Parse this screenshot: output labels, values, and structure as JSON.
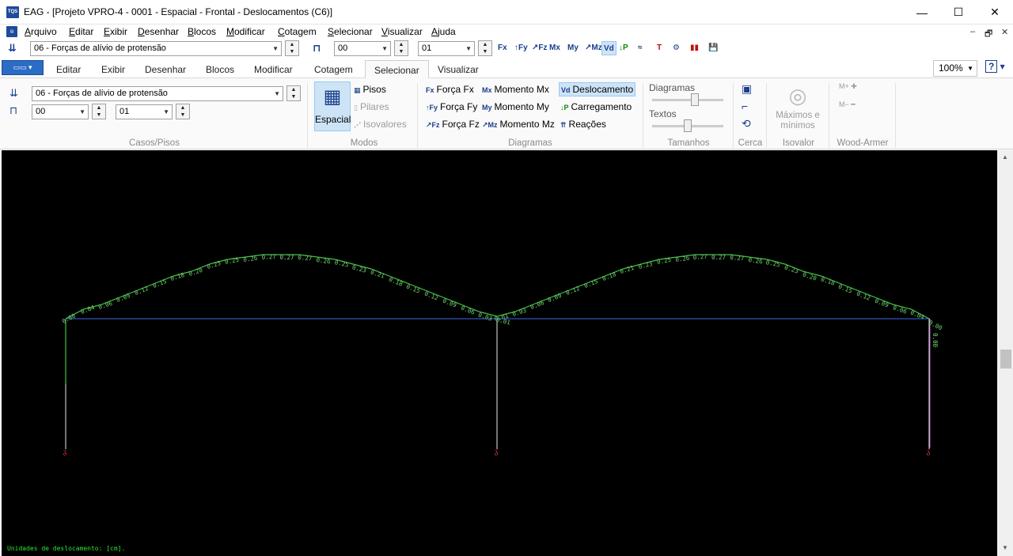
{
  "window": {
    "title": "EAG - [Projeto VPRO-4 - 0001 - Espacial - Frontal - Deslocamentos (C6)]",
    "app_icon": "TQS",
    "minimize_glyph": "—",
    "maximize_glyph": "☐",
    "close_glyph": "✕"
  },
  "menu": [
    "Arquivo",
    "Editar",
    "Exibir",
    "Desenhar",
    "Blocos",
    "Modificar",
    "Cotagem",
    "Selecionar",
    "Visualizar",
    "Ajuda"
  ],
  "mdi_controls": [
    "–",
    "🗗",
    "✕"
  ],
  "toolbar": {
    "case_value": "06 - Forças de alívio de protensão",
    "floor_from": "00",
    "floor_to": "01",
    "icons": [
      "fx-icon",
      "fy-icon",
      "fz-icon",
      "mx-icon",
      "my-icon",
      "mz-icon",
      "displacement-icon",
      "load-icon",
      "reactions-icon",
      "beam-icon",
      "settings-icon",
      "colors-icon",
      "save-icon"
    ],
    "icon_glyphs": [
      "Fx",
      "↑Fy",
      "↗Fz",
      "Mx",
      "My",
      "↗Mz",
      "Vd",
      "↓P",
      "≈",
      "T",
      "⚙",
      "▮▮",
      "💾"
    ]
  },
  "tabs": {
    "file_tab_label": "▭▭ ▾",
    "items": [
      "Editar",
      "Exibir",
      "Desenhar",
      "Blocos",
      "Modificar",
      "Cotagem",
      "Selecionar",
      "Visualizar"
    ],
    "active": "Selecionar"
  },
  "zoom": {
    "value": "100%"
  },
  "help_label": "?",
  "ribbon": {
    "casos_pisos": {
      "case_value": "06 - Forças de alívio de protensão",
      "floor_from": "00",
      "floor_to": "01",
      "label": "Casos/Pisos"
    },
    "modos": {
      "espacial": "Espacial",
      "pisos": "Pisos",
      "pilares": "Pilares",
      "isovalores": "Isovalores",
      "label": "Modos"
    },
    "diagramas": {
      "forca_fx": "Força Fx",
      "forca_fy": "Força Fy",
      "forca_fz": "Força Fz",
      "momento_mx": "Momento Mx",
      "momento_my": "Momento My",
      "momento_mz": "Momento Mz",
      "deslocamento": "Deslocamento",
      "carregamento": "Carregamento",
      "reacoes": "Reações",
      "label": "Diagramas"
    },
    "tamanhos": {
      "diagramas": "Diagramas",
      "textos": "Textos",
      "label": "Tamanhos",
      "diagramas_level": 0.6,
      "textos_level": 0.5
    },
    "cerca": {
      "label": "Cerca"
    },
    "isovalor": {
      "maximos": "Máximos e",
      "minimos": "mínimos",
      "label": "Isovalor"
    },
    "wood_armer": {
      "label": "Wood-Armer"
    }
  },
  "canvas": {
    "status_text": "Unidades de deslocamento: [cm].",
    "labels_left": [
      "0.00",
      "0.04",
      "0.06",
      "0.09",
      "0.12",
      "0.15",
      "0.18",
      "0.20",
      "0.23",
      "0.25",
      "0.26",
      "0.27",
      "0.27",
      "0.27",
      "0.26",
      "0.25",
      "0.23",
      "0.21",
      "0.18",
      "0.15",
      "0.12",
      "0.09",
      "0.06",
      "0.03",
      "0.01"
    ],
    "labels_right": [
      "0.01",
      "0.03",
      "0.06",
      "0.09",
      "0.12",
      "0.15",
      "0.18",
      "0.21",
      "0.23",
      "0.25",
      "0.26",
      "0.27",
      "0.27",
      "0.27",
      "0.26",
      "0.25",
      "0.23",
      "0.20",
      "0.18",
      "0.15",
      "0.12",
      "0.09",
      "0.06",
      "0.04",
      "0.00"
    ],
    "column_label": "0.00"
  },
  "colors": {
    "beam": "#3b6ae8",
    "diagram": "#48c048",
    "support": "#ff3a3a",
    "titlebar_accent": "#1e4b9b"
  }
}
